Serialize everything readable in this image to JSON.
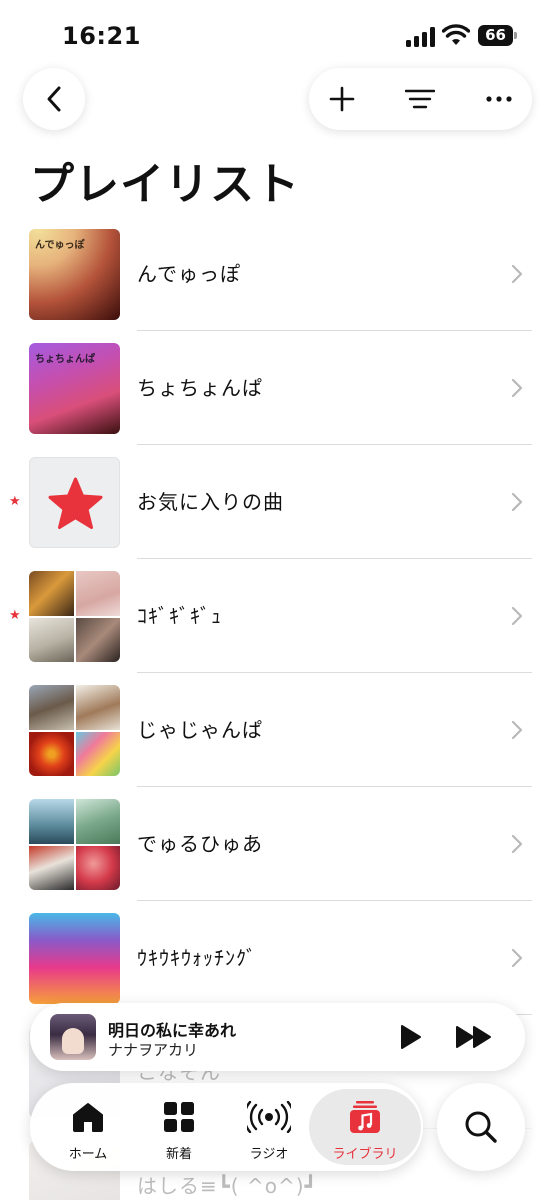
{
  "status_bar": {
    "time": "16:21",
    "battery": "66"
  },
  "nav": {
    "back_icon": "chevron-left-icon",
    "actions": [
      "plus-icon",
      "filter-icon",
      "more-icon"
    ]
  },
  "page_title": "プレイリスト",
  "playlists": [
    {
      "label": "んでゅっぽ",
      "art_text": "んでゅっぽ",
      "favorite": false
    },
    {
      "label": "ちょちょんぱ",
      "art_text": "ちょちょんぱ",
      "favorite": false
    },
    {
      "label": "お気に入りの曲",
      "favorite": true
    },
    {
      "label": "ｺｷﾞｷﾞｷﾞｭ",
      "favorite": true
    },
    {
      "label": "じゃじゃんぱ",
      "favorite": false
    },
    {
      "label": "でゅるひゅあ",
      "favorite": false
    },
    {
      "label": "ｳｷｳｷｳｫｯﾁﾝｸﾞ",
      "favorite": false
    },
    {
      "label": "こなそん",
      "favorite": false
    },
    {
      "label": "はしる≡┗( ^o^)┛",
      "favorite": false
    }
  ],
  "mini_player": {
    "title": "明日の私に幸あれ",
    "artist": "ナナヲアカリ"
  },
  "tabs": [
    {
      "label": "ホーム",
      "icon": "home-icon"
    },
    {
      "label": "新着",
      "icon": "grid-icon"
    },
    {
      "label": "ラジオ",
      "icon": "radio-icon"
    },
    {
      "label": "ライブラリ",
      "icon": "music-library-icon",
      "active": true
    }
  ],
  "colors": {
    "accent": "#e8323c",
    "divider": "#dcdcdc"
  }
}
